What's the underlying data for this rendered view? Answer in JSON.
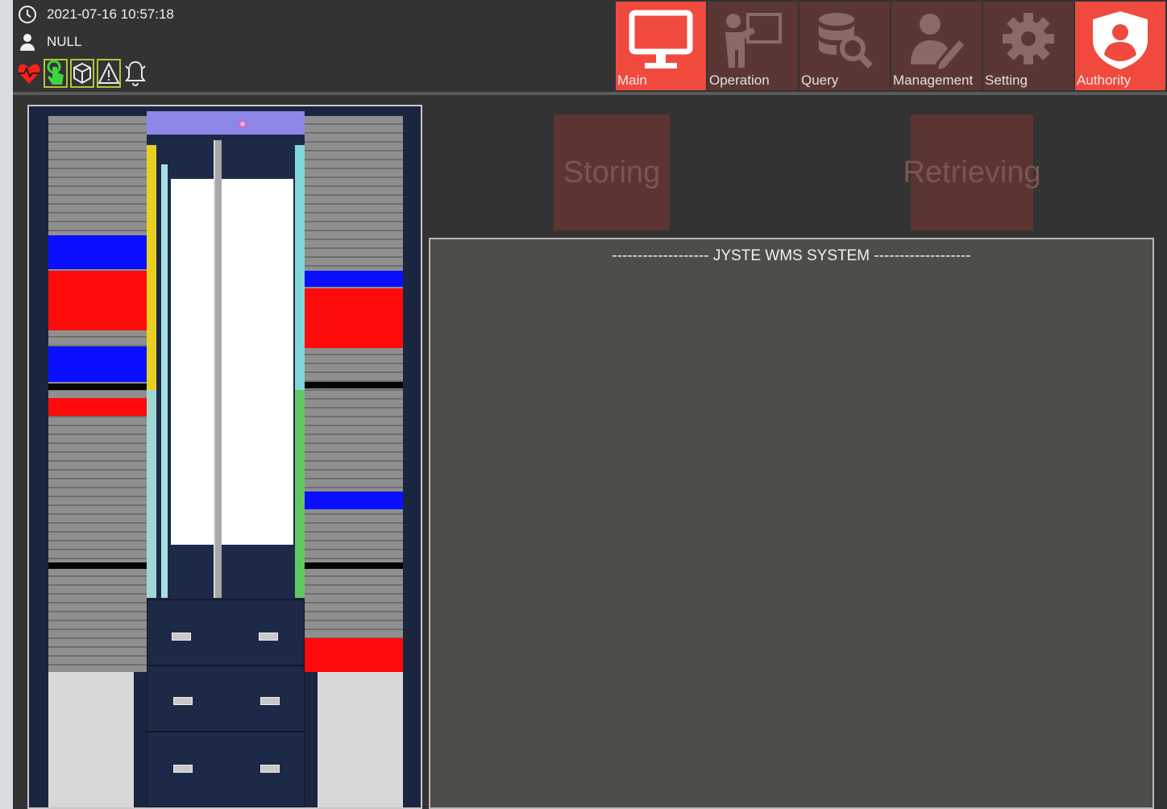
{
  "header": {
    "datetime": "2021-07-16 10:57:18",
    "user": "NULL",
    "status_icons": [
      {
        "icon": "heartbeat-icon",
        "color": "#ff2020"
      },
      {
        "icon": "touch-hand-icon",
        "color": "#3fd43f"
      },
      {
        "icon": "cube-scan-icon",
        "color": "#e8e8e8"
      },
      {
        "icon": "warning-icon",
        "color": "#e8e8e8"
      },
      {
        "icon": "alarm-bell-icon",
        "color": "#e8e8e8"
      }
    ]
  },
  "nav": [
    {
      "label": "Main",
      "icon": "monitor-icon",
      "active": true
    },
    {
      "label": "Operation",
      "icon": "presenter-icon",
      "active": false
    },
    {
      "label": "Query",
      "icon": "database-search-icon",
      "active": false
    },
    {
      "label": "Management",
      "icon": "user-edit-icon",
      "active": false
    },
    {
      "label": "Setting",
      "icon": "gear-icon",
      "active": false
    },
    {
      "label": "Authority",
      "icon": "shield-user-icon",
      "active": true
    }
  ],
  "actions": {
    "storing": "Storing",
    "retrieving": "Retrieving"
  },
  "log": {
    "title": "------------------- JYSTE WMS SYSTEM -------------------"
  },
  "colors": {
    "accent": "#f04a3e",
    "inactive_tab": "#5a3634",
    "occupied_blue": "#0a10ff",
    "occupied_red": "#ff0b0b"
  }
}
